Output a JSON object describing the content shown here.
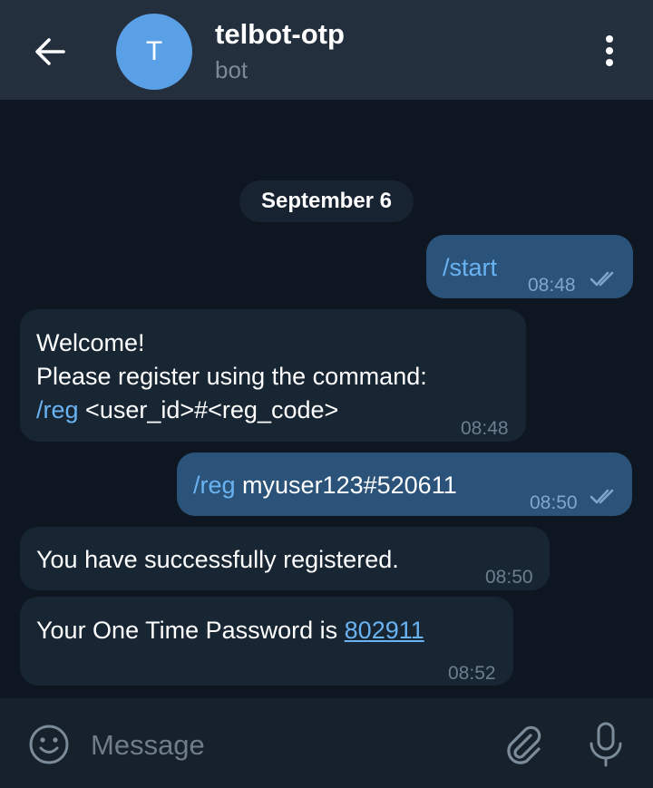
{
  "header": {
    "avatar_letter": "T",
    "title": "telbot-otp",
    "subtitle": "bot"
  },
  "chat": {
    "date": "September 6",
    "messages": [
      {
        "direction": "out",
        "command": "/start",
        "text": "",
        "time": "08:48",
        "status": "read"
      },
      {
        "direction": "in",
        "line1": "Welcome!",
        "line2": "Please register using the command:",
        "command": "/reg",
        "text": "<user_id>#<reg_code>",
        "time": "08:48"
      },
      {
        "direction": "out",
        "command": "/reg",
        "text": "myuser123#520611",
        "time": "08:50",
        "status": "read"
      },
      {
        "direction": "in",
        "text": "You have successfully registered.",
        "time": "08:50"
      },
      {
        "direction": "in",
        "text": "Your One Time Password is ",
        "link": "802911",
        "time": "08:52"
      }
    ]
  },
  "composer": {
    "placeholder": "Message"
  },
  "colors": {
    "header_bg": "#242f3d",
    "chat_bg": "#0e1621",
    "outgoing_bubble": "#2b5278",
    "incoming_bubble": "#182533",
    "accent": "#6ab3f3",
    "avatar": "#5aa0e6"
  },
  "icons": {
    "back": "arrow-left-icon",
    "menu": "more-vertical-icon",
    "emoji": "smile-icon",
    "attach": "paperclip-icon",
    "mic": "microphone-icon",
    "read": "double-check-icon"
  }
}
